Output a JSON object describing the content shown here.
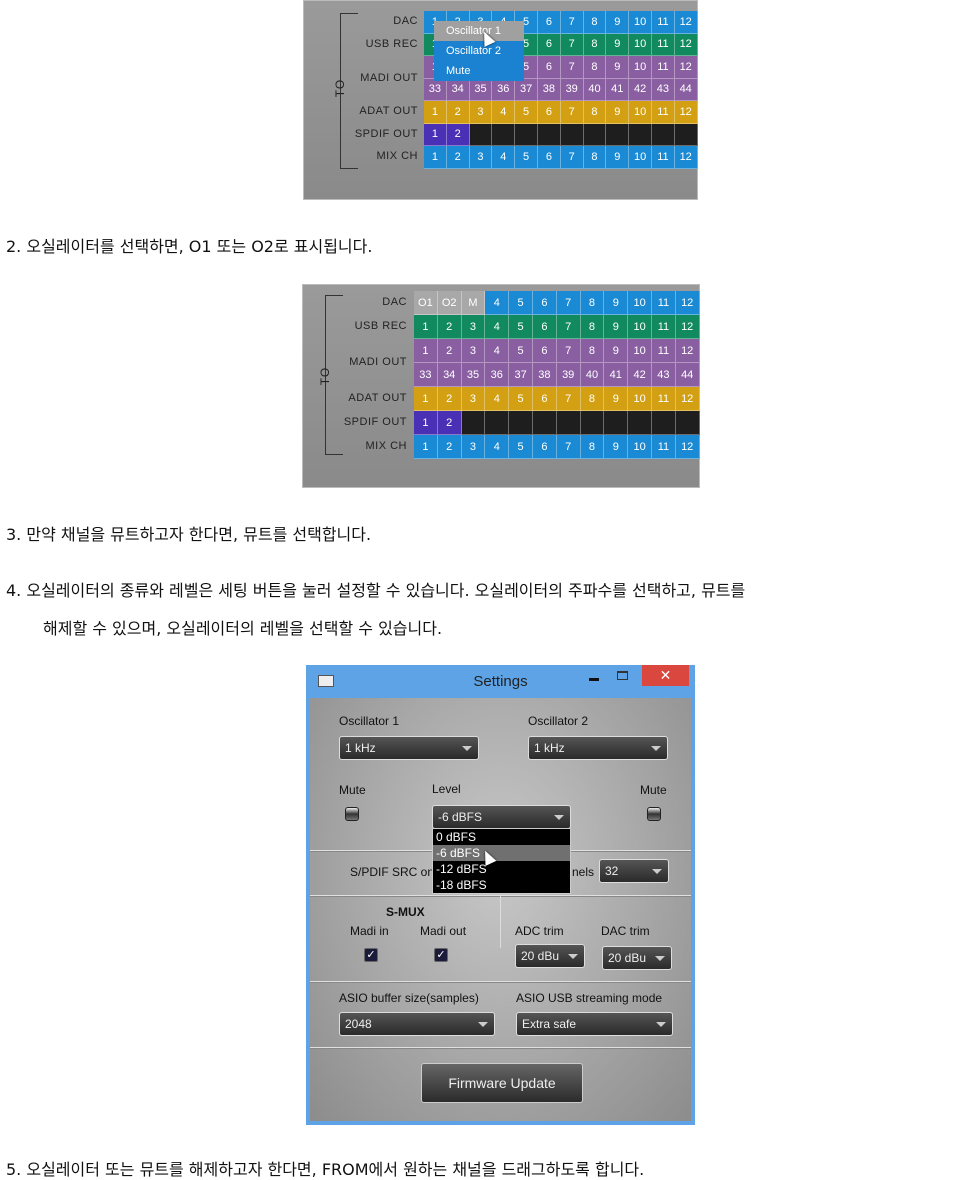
{
  "routing_top": {
    "to_label": "TO",
    "rows": [
      {
        "label": "DAC",
        "color": "#1a8ad4",
        "cells": [
          "1",
          "2",
          "3",
          "4",
          "5",
          "6",
          "7",
          "8",
          "9",
          "10",
          "11",
          "12"
        ]
      },
      {
        "label": "USB REC",
        "color": "#128a60",
        "cells": [
          "1",
          "2",
          "3",
          "4",
          "5",
          "6",
          "7",
          "8",
          "9",
          "10",
          "11",
          "12"
        ]
      },
      {
        "label": "MADI OUT",
        "color": "#8a5fa2",
        "cells": [
          "1",
          "2",
          "3",
          "4",
          "5",
          "6",
          "7",
          "8",
          "9",
          "10",
          "11",
          "12"
        ],
        "cells2": [
          "33",
          "34",
          "35",
          "36",
          "37",
          "38",
          "39",
          "40",
          "41",
          "42",
          "43",
          "44"
        ]
      },
      {
        "label": "ADAT OUT",
        "color": "#d2a012",
        "cells": [
          "1",
          "2",
          "3",
          "4",
          "5",
          "6",
          "7",
          "8",
          "9",
          "10",
          "11",
          "12"
        ]
      },
      {
        "label": "SPDIF OUT",
        "color": "#4a30b4",
        "cells": [
          "1",
          "2",
          "",
          "",
          "",
          "",
          "",
          "",
          "",
          "",
          "",
          ""
        ]
      },
      {
        "label": "MIX CH",
        "color": "#1a8ad4",
        "cells": [
          "1",
          "2",
          "3",
          "4",
          "5",
          "6",
          "7",
          "8",
          "9",
          "10",
          "11",
          "12"
        ]
      }
    ],
    "context_menu": [
      "Oscillator 1",
      "Oscillator 2",
      "Mute"
    ],
    "context_menu_highlighted": "Oscillator 1"
  },
  "step2": "2.  오실레이터를 선택하면, O1 또는 O2로 표시됩니다.",
  "routing_bottom": {
    "to_label": "TO",
    "rows": [
      {
        "label": "DAC",
        "color": "#1a8ad4",
        "cells": [
          "O1",
          "O2",
          "M",
          "4",
          "5",
          "6",
          "7",
          "8",
          "9",
          "10",
          "11",
          "12"
        ]
      },
      {
        "label": "USB REC",
        "color": "#128a60",
        "cells": [
          "1",
          "2",
          "3",
          "4",
          "5",
          "6",
          "7",
          "8",
          "9",
          "10",
          "11",
          "12"
        ]
      },
      {
        "label": "MADI OUT",
        "color": "#8a5fa2",
        "cells": [
          "1",
          "2",
          "3",
          "4",
          "5",
          "6",
          "7",
          "8",
          "9",
          "10",
          "11",
          "12"
        ],
        "cells2": [
          "33",
          "34",
          "35",
          "36",
          "37",
          "38",
          "39",
          "40",
          "41",
          "42",
          "43",
          "44"
        ]
      },
      {
        "label": "ADAT OUT",
        "color": "#d2a012",
        "cells": [
          "1",
          "2",
          "3",
          "4",
          "5",
          "6",
          "7",
          "8",
          "9",
          "10",
          "11",
          "12"
        ]
      },
      {
        "label": "SPDIF OUT",
        "color": "#4a30b4",
        "cells": [
          "1",
          "2",
          "",
          "",
          "",
          "",
          "",
          "",
          "",
          "",
          "",
          ""
        ]
      },
      {
        "label": "MIX CH",
        "color": "#1a8ad4",
        "cells": [
          "1",
          "2",
          "3",
          "4",
          "5",
          "6",
          "7",
          "8",
          "9",
          "10",
          "11",
          "12"
        ]
      }
    ],
    "assigned_color": "#a8a8a8"
  },
  "step3": "3.  만약 채널을 뮤트하고자 한다면, 뮤트를 선택합니다.",
  "step4_line1": "4.  오실레이터의 종류와 레벨은 세팅 버튼을 눌러 설정할 수 있습니다. 오실레이터의 주파수를 선택하고, 뮤트를",
  "step4_line2": "해제할 수 있으며, 오실레이터의 레벨을 선택할 수 있습니다.",
  "settings": {
    "title": "Settings",
    "close": "✕",
    "osc1_label": "Oscillator 1",
    "osc1_value": "1 kHz",
    "osc2_label": "Oscillator 2",
    "osc2_value": "1 kHz",
    "mute_left": "Mute",
    "mute_right": "Mute",
    "level_label": "Level",
    "level_value": "-6 dBFS",
    "level_options": [
      "0 dBFS",
      "-6 dBFS",
      "-12 dBFS",
      "-18 dBFS"
    ],
    "spdif_label": "S/PDIF SRC on",
    "channels_label_fragment": "nels",
    "channels_value": "32",
    "smux_label": "S-MUX",
    "madi_in": "Madi in",
    "madi_out": "Madi out",
    "madi_in_checked": true,
    "madi_out_checked": true,
    "adc_trim_label": "ADC trim",
    "adc_trim_value": "20 dBu",
    "dac_trim_label": "DAC trim",
    "dac_trim_value": "20 dBu",
    "asio_buffer_label": "ASIO buffer size(samples)",
    "asio_buffer_value": "2048",
    "asio_mode_label": "ASIO USB streaming mode",
    "asio_mode_value": "Extra safe",
    "firmware_button": "Firmware Update"
  },
  "step5": "5.  오실레이터 또는 뮤트를 해제하고자 한다면, FROM에서 원하는 채널을 드래그하도록 합니다."
}
